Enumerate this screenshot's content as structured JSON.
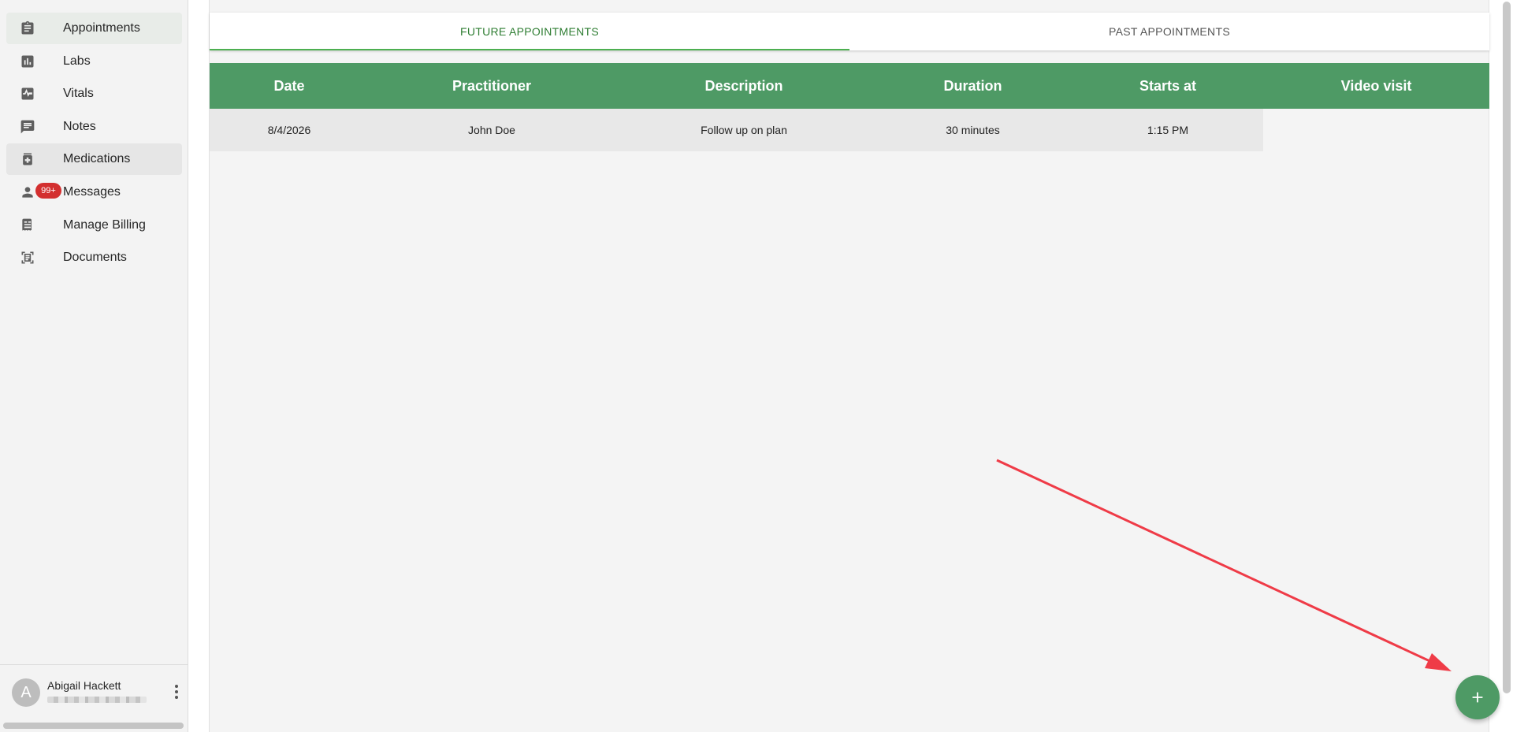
{
  "sidebar": {
    "items": [
      {
        "label": "Appointments",
        "icon": "clipboard-icon",
        "state": "active"
      },
      {
        "label": "Labs",
        "icon": "lab-chart-icon",
        "state": ""
      },
      {
        "label": "Vitals",
        "icon": "heartbeat-icon",
        "state": ""
      },
      {
        "label": "Notes",
        "icon": "chat-note-icon",
        "state": ""
      },
      {
        "label": "Medications",
        "icon": "medication-bottle-icon",
        "state": "hover"
      },
      {
        "label": "Messages",
        "icon": "person-icon",
        "state": "",
        "badge": "99+"
      },
      {
        "label": "Manage Billing",
        "icon": "receipt-icon",
        "state": ""
      },
      {
        "label": "Documents",
        "icon": "document-scan-icon",
        "state": ""
      }
    ],
    "user": {
      "initial": "A",
      "name": "Abigail Hackett"
    }
  },
  "tabs": {
    "future": "FUTURE APPOINTMENTS",
    "past": "PAST APPOINTMENTS"
  },
  "table": {
    "headers": [
      "Date",
      "Practitioner",
      "Description",
      "Duration",
      "Starts at",
      "Video visit"
    ],
    "rows": [
      [
        "8/4/2026",
        "John Doe",
        "Follow up on plan",
        "30 minutes",
        "1:15 PM",
        ""
      ]
    ]
  },
  "colors": {
    "accent": "#4e9a65",
    "tab_active": "#2e7d32",
    "badge": "#d32f2f",
    "annotation_arrow": "#ef3b47"
  },
  "fab": {
    "icon": "plus-icon"
  }
}
